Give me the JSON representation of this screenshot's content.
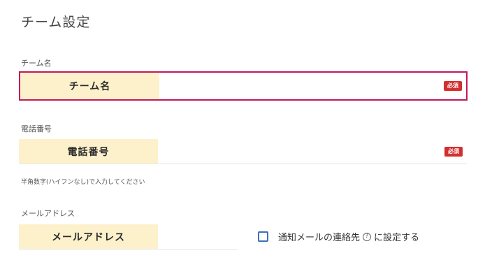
{
  "page": {
    "title": "チーム設定"
  },
  "team_name": {
    "label": "チーム名",
    "prefix": "チーム名",
    "value": "",
    "required_badge": "必須"
  },
  "phone": {
    "label": "電話番号",
    "prefix": "電話番号",
    "value": "",
    "required_badge": "必須",
    "hint": "半角数字(ハイフンなし)で入力してください"
  },
  "email": {
    "label": "メールアドレス",
    "prefix": "メールアドレス",
    "value": "",
    "notify_checkbox": {
      "label_before": "通知メールの連絡先",
      "help_icon": "?",
      "label_after": "に設定する",
      "checked": false
    }
  },
  "colors": {
    "prefix_bg": "#fdf1cc",
    "focus_border": "#c2185b",
    "required_bg": "#d32f2f",
    "checkbox_border": "#3f6fb5"
  }
}
